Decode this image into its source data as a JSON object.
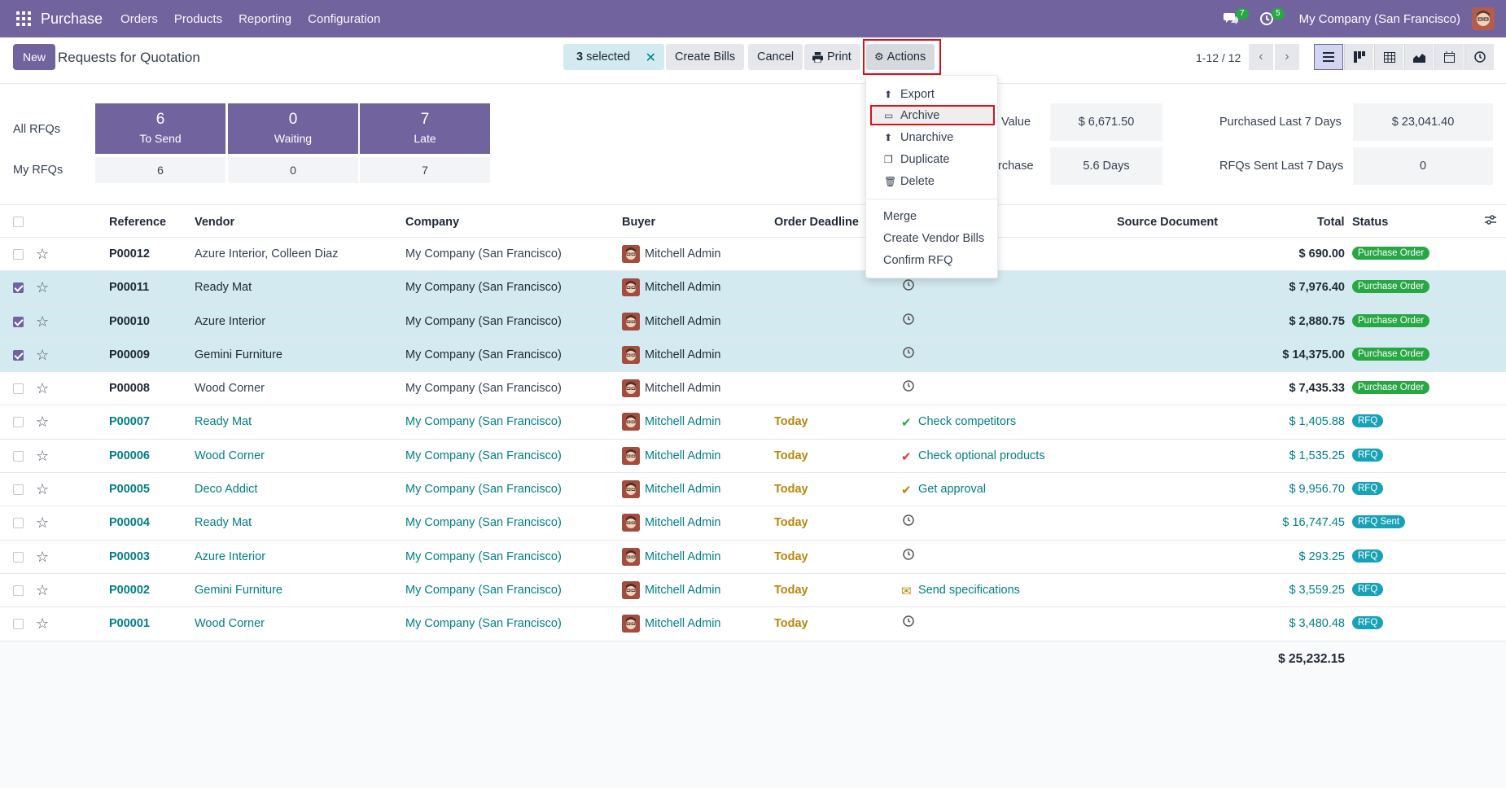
{
  "navbar": {
    "brand": "Purchase",
    "menu": [
      "Orders",
      "Products",
      "Reporting",
      "Configuration"
    ],
    "chat_count": "7",
    "activity_count": "5",
    "company": "My Company (San Francisco)"
  },
  "control": {
    "new_label": "New",
    "title": "Requests for Quotation",
    "selected_count": "3",
    "selected_label": "selected",
    "create_bills": "Create Bills",
    "cancel": "Cancel",
    "print": "Print",
    "actions": "Actions",
    "pager": "1-12 / 12"
  },
  "dashboard": {
    "all_label": "All RFQs",
    "my_label": "My RFQs",
    "tiles": [
      {
        "num": "6",
        "label": "To Send",
        "mine": "6"
      },
      {
        "num": "0",
        "label": "Waiting",
        "mine": "0"
      },
      {
        "num": "7",
        "label": "Late",
        "mine": "7"
      }
    ],
    "stat1_label": "Value",
    "stat1_value": "$ 6,671.50",
    "stat2_label": "rchase",
    "stat2_value": "5.6 Days",
    "stat3_label": "Purchased Last 7 Days",
    "stat3_value": "$ 23,041.40",
    "stat4_label": "RFQs Sent Last 7 Days",
    "stat4_value": "0"
  },
  "table": {
    "headers": {
      "reference": "Reference",
      "vendor": "Vendor",
      "company": "Company",
      "buyer": "Buyer",
      "deadline": "Order Deadline",
      "source": "Source Document",
      "total": "Total",
      "status": "Status"
    },
    "rows": [
      {
        "ref": "P00012",
        "vendor": "Azure Interior, Colleen Diaz",
        "company": "My Company (San Francisco)",
        "buyer": "Mitchell Admin",
        "deadline": "",
        "activity": "",
        "total": "$ 690.00",
        "status": "Purchase Order"
      },
      {
        "ref": "P00011",
        "vendor": "Ready Mat",
        "company": "My Company (San Francisco)",
        "buyer": "Mitchell Admin",
        "deadline": "",
        "activity": "",
        "total": "$ 7,976.40",
        "status": "Purchase Order"
      },
      {
        "ref": "P00010",
        "vendor": "Azure Interior",
        "company": "My Company (San Francisco)",
        "buyer": "Mitchell Admin",
        "deadline": "",
        "activity": "",
        "total": "$ 2,880.75",
        "status": "Purchase Order"
      },
      {
        "ref": "P00009",
        "vendor": "Gemini Furniture",
        "company": "My Company (San Francisco)",
        "buyer": "Mitchell Admin",
        "deadline": "",
        "activity": "",
        "total": "$ 14,375.00",
        "status": "Purchase Order"
      },
      {
        "ref": "P00008",
        "vendor": "Wood Corner",
        "company": "My Company (San Francisco)",
        "buyer": "Mitchell Admin",
        "deadline": "",
        "activity": "",
        "total": "$ 7,435.33",
        "status": "Purchase Order"
      },
      {
        "ref": "P00007",
        "vendor": "Ready Mat",
        "company": "My Company (San Francisco)",
        "buyer": "Mitchell Admin",
        "deadline": "Today",
        "activity": "Check competitors",
        "total": "$ 1,405.88",
        "status": "RFQ"
      },
      {
        "ref": "P00006",
        "vendor": "Wood Corner",
        "company": "My Company (San Francisco)",
        "buyer": "Mitchell Admin",
        "deadline": "Today",
        "activity": "Check optional products",
        "total": "$ 1,535.25",
        "status": "RFQ"
      },
      {
        "ref": "P00005",
        "vendor": "Deco Addict",
        "company": "My Company (San Francisco)",
        "buyer": "Mitchell Admin",
        "deadline": "Today",
        "activity": "Get approval",
        "total": "$ 9,956.70",
        "status": "RFQ"
      },
      {
        "ref": "P00004",
        "vendor": "Ready Mat",
        "company": "My Company (San Francisco)",
        "buyer": "Mitchell Admin",
        "deadline": "Today",
        "activity": "",
        "total": "$ 16,747.45",
        "status": "RFQ Sent"
      },
      {
        "ref": "P00003",
        "vendor": "Azure Interior",
        "company": "My Company (San Francisco)",
        "buyer": "Mitchell Admin",
        "deadline": "Today",
        "activity": "",
        "total": "$ 293.25",
        "status": "RFQ"
      },
      {
        "ref": "P00002",
        "vendor": "Gemini Furniture",
        "company": "My Company (San Francisco)",
        "buyer": "Mitchell Admin",
        "deadline": "Today",
        "activity": "Send specifications",
        "total": "$ 3,559.25",
        "status": "RFQ"
      },
      {
        "ref": "P00001",
        "vendor": "Wood Corner",
        "company": "My Company (San Francisco)",
        "buyer": "Mitchell Admin",
        "deadline": "Today",
        "activity": "",
        "total": "$ 3,480.48",
        "status": "RFQ"
      }
    ],
    "grand_total": "$ 25,232.15"
  },
  "dropdown": {
    "export": "Export",
    "archive": "Archive",
    "unarchive": "Unarchive",
    "duplicate": "Duplicate",
    "delete": "Delete",
    "merge": "Merge",
    "create_vendor_bills": "Create Vendor Bills",
    "confirm_rfq": "Confirm RFQ"
  }
}
